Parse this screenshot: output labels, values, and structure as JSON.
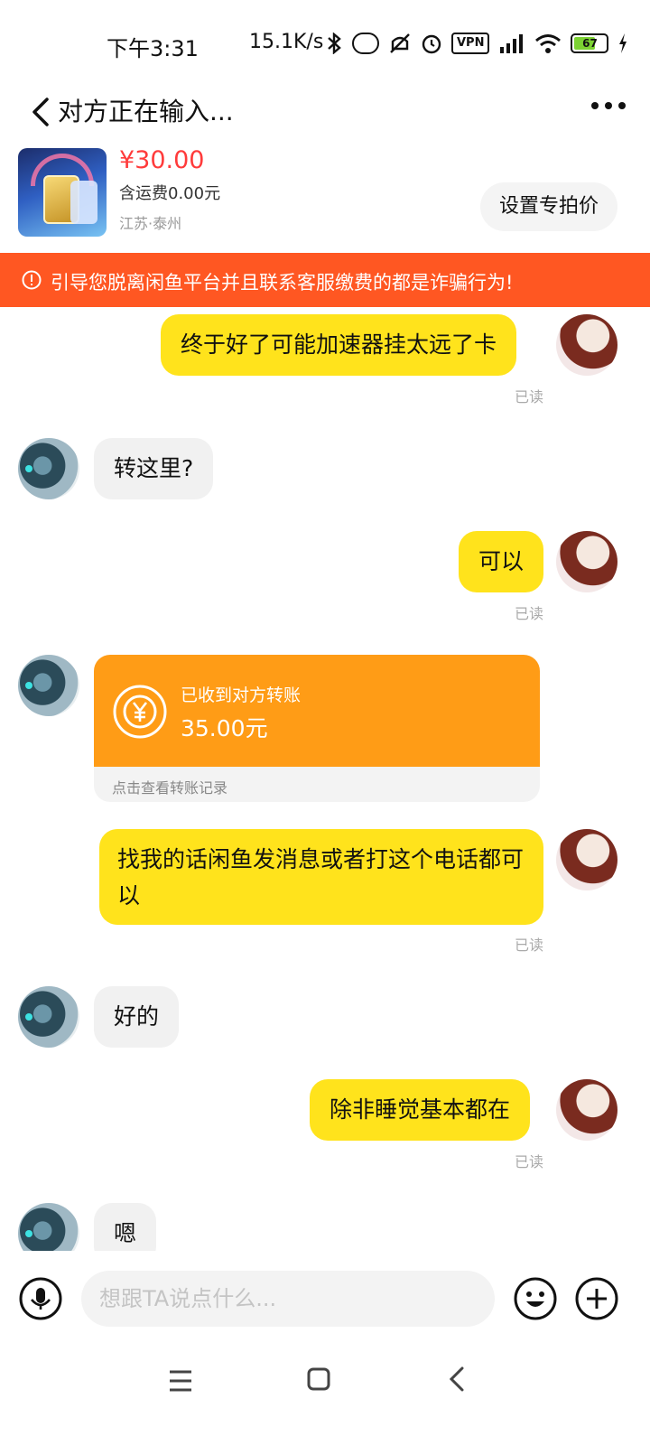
{
  "status_bar": {
    "time": "下午3:31",
    "net_speed": "15.1K/s",
    "vpn": "VPN",
    "battery": "67"
  },
  "header": {
    "title": "对方正在输入..."
  },
  "product": {
    "price": "¥30.00",
    "shipping": "含运费0.00元",
    "location": "江苏·泰州",
    "special_price_button": "设置专拍价"
  },
  "warning": {
    "text": "引导您脱离闲鱼平台并且联系客服缴费的都是诈骗行为!"
  },
  "messages": [
    {
      "side": "me",
      "text": "终于好了可能加速器挂太远了卡",
      "read": "已读"
    },
    {
      "side": "them",
      "text": "转这里?"
    },
    {
      "side": "me",
      "text": "可以",
      "read": "已读"
    },
    {
      "side": "them",
      "type": "transfer",
      "status": "已收到对方转账",
      "amount": "35.00元",
      "link": "点击查看转账记录"
    },
    {
      "side": "me",
      "text": "找我的话闲鱼发消息或者打这个电话都可以",
      "read": "已读"
    },
    {
      "side": "them",
      "text": "好的"
    },
    {
      "side": "me",
      "text": "除非睡觉基本都在",
      "read": "已读"
    },
    {
      "side": "them",
      "text": "嗯"
    }
  ],
  "input": {
    "placeholder": "想跟TA说点什么..."
  },
  "colors": {
    "accent_yellow": "#ffe31c",
    "warning_orange": "#ff5722",
    "transfer_orange": "#ff9c16",
    "price_red": "#ff3b3b"
  }
}
